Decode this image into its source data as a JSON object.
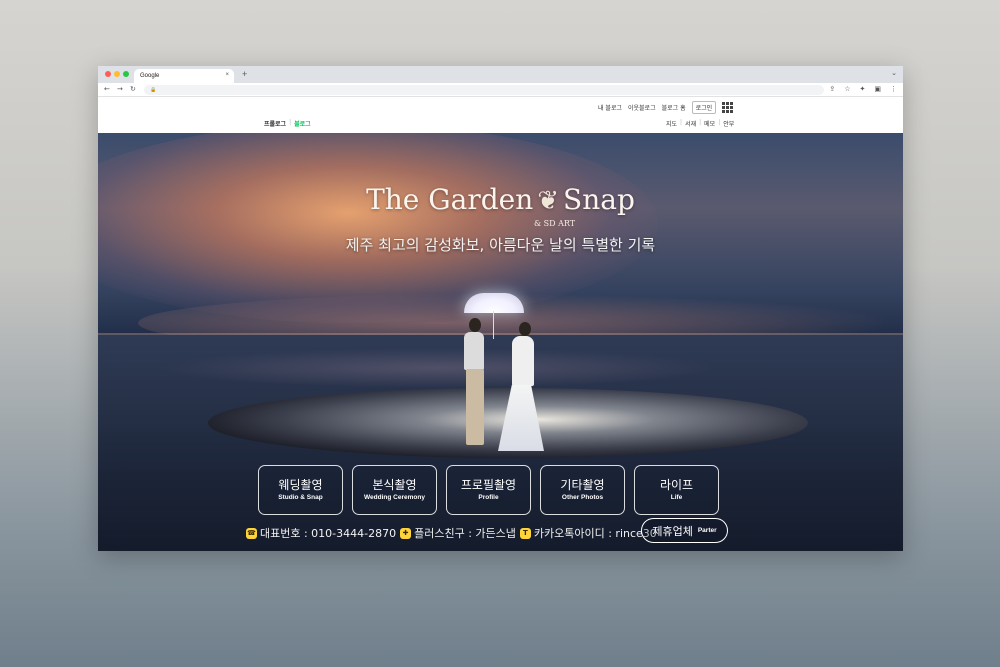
{
  "browser": {
    "tab_title": "Google",
    "tab_close": "×",
    "new_tab": "+",
    "tab_dropdown": "⌄",
    "address_url": "",
    "nav_back": "←",
    "nav_forward": "→",
    "nav_reload": "↻",
    "lock": "🔒",
    "tools": [
      "⇪",
      "☆",
      "✦",
      "▣",
      "⋮"
    ]
  },
  "topbar": {
    "links": [
      "내 블로그",
      "이웃블로그",
      "블로그 홈"
    ],
    "login_label": "로그인",
    "blog_label_prologue": "프롤로그",
    "blog_separator": "|",
    "blog_label_blog": "블로그",
    "subnav": [
      "지도",
      "서재",
      "메모",
      "안부"
    ],
    "subnav_separator": "|"
  },
  "hero": {
    "logo_left": "The Garden",
    "logo_right": "Snap",
    "logo_leaf": "❦",
    "logo_sub": "& SD ART",
    "tagline": "제주 최고의 감성화보, 아름다운 날의 특별한 기록"
  },
  "menu": [
    {
      "ko": "웨딩촬영",
      "en": "Studio & Snap"
    },
    {
      "ko": "본식촬영",
      "en": "Wedding Ceremony"
    },
    {
      "ko": "프로필촬영",
      "en": "Profile"
    },
    {
      "ko": "기타촬영",
      "en": "Other Photos"
    },
    {
      "ko": "라이프",
      "en": "Life"
    }
  ],
  "contact": {
    "phone_icon": "☎",
    "phone": "대표번호 : 010-3444-2870",
    "plus_icon": "✚",
    "plus_friend": "플러스친구 : 가든스냅",
    "kakao_icon": "T",
    "kakao": "카카오톡아이디 : rince30",
    "partner_ko": "제휴업체",
    "partner_en": "Parter"
  },
  "colors": {
    "green_accent": "#03c75a",
    "yellow_icon": "#ffd43b"
  }
}
